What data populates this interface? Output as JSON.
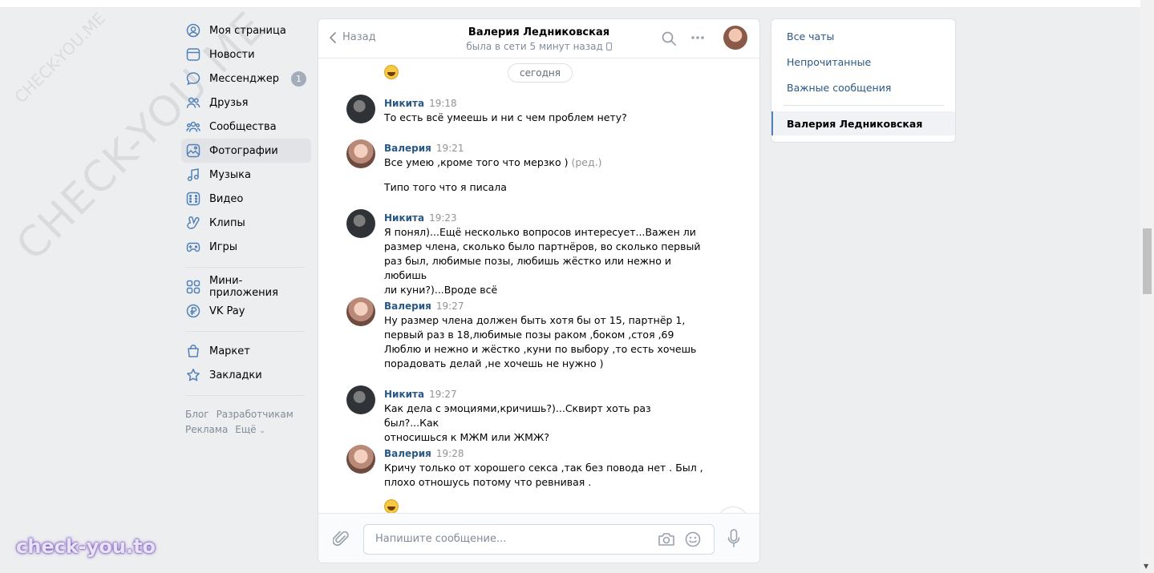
{
  "watermark": {
    "big": "CHECK-YOU.ME",
    "small": "CHECK-YOU.ME",
    "brand": "check-you.to"
  },
  "nav": {
    "items": [
      {
        "label": "Моя страница",
        "icon": "user-circle-icon"
      },
      {
        "label": "Новости",
        "icon": "news-icon"
      },
      {
        "label": "Мессенджер",
        "icon": "message-icon",
        "badge": "1"
      },
      {
        "label": "Друзья",
        "icon": "friends-icon"
      },
      {
        "label": "Сообщества",
        "icon": "communities-icon"
      },
      {
        "label": "Фотографии",
        "icon": "photos-icon",
        "active": true
      },
      {
        "label": "Музыка",
        "icon": "music-icon"
      },
      {
        "label": "Видео",
        "icon": "video-icon"
      },
      {
        "label": "Клипы",
        "icon": "clips-icon"
      },
      {
        "label": "Игры",
        "icon": "games-icon"
      }
    ],
    "items2": [
      {
        "label": "Мини-приложения",
        "icon": "apps-icon"
      },
      {
        "label": "VK Pay",
        "icon": "vkpay-icon"
      }
    ],
    "items3": [
      {
        "label": "Маркет",
        "icon": "market-icon"
      },
      {
        "label": "Закладки",
        "icon": "bookmark-icon"
      }
    ],
    "footer": {
      "blog": "Блог",
      "devs": "Разработчикам",
      "ads": "Реклама",
      "more": "Ещё"
    }
  },
  "chat": {
    "back_label": "Назад",
    "peer_name": "Валерия Ледниковская",
    "peer_status": "была в сети 5 минут назад",
    "date_pill": "сегодня",
    "messages": [
      {
        "author": "Никита",
        "time": "19:18",
        "text": "То есть всё умеешь и ни с чем проблем нету?",
        "sender": "nikita"
      },
      {
        "author": "Валерия",
        "time": "19:21",
        "text": "Все умею ,кроме того что мерзко )",
        "edited": "(ред.)",
        "text2": "Типо того что я писала",
        "sender": "valeria"
      },
      {
        "author": "Никита",
        "time": "19:23",
        "text": "Я понял)...Ещё несколько вопросов интересует...Важен ли\nразмер члена, сколько было партнёров, во сколько первый\nраз был, любимые позы, любишь жёстко или нежно и любишь\nли куни?)...Вроде всё",
        "sender": "nikita"
      },
      {
        "author": "Валерия",
        "time": "19:27",
        "text": "Ну размер члена должен быть хотя бы от 15, партнёр 1,\nпервый раз в 18,любимые позы раком ,боком ,стоя ,69\nЛюблю и нежно и жёстко ,куни по выбору ,то есть хочешь\nпорадовать делай ,не хочешь не нужно )",
        "sender": "valeria"
      },
      {
        "author": "Никита",
        "time": "19:27",
        "text": "Как дела с эмоциями,кричишь?)...Сквирт хоть раз был?...Как\nотносишься к МЖМ или ЖМЖ?",
        "sender": "nikita"
      },
      {
        "author": "Валерия",
        "time": "19:28",
        "text": "Кричу только от хорошего секса ,так без повода нет . Был ,\nплохо отношусь потому что ревнивая .",
        "sender": "valeria"
      }
    ],
    "input_placeholder": "Напишите сообщение..."
  },
  "right_panel": {
    "all_chats": "Все чаты",
    "unread": "Непрочитанные",
    "important": "Важные сообщения",
    "active_chat": "Валерия Ледниковская"
  }
}
